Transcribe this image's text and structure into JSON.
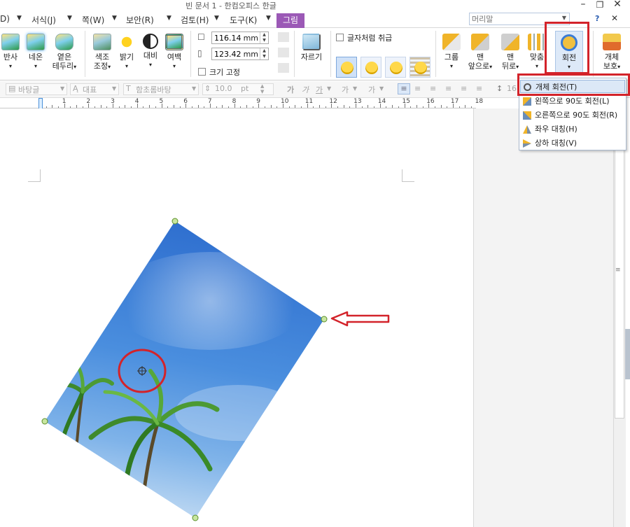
{
  "titlebar": {
    "title": "빈 문서 1 - 한컴오피스 한글",
    "min_glyph": "–",
    "max_glyph": "❐",
    "close_glyph": "✕"
  },
  "menubar": {
    "items": [
      "D)",
      "서식(J)",
      "쪽(W)",
      "보안(R)",
      "검토(H)",
      "도구(K)"
    ],
    "active_tab": "그림",
    "search_placeholder": "머리말",
    "help_glyph": "?",
    "ribbon_close_glyph": "✕"
  },
  "ribbon": {
    "reflect": "반사",
    "neon": "네온",
    "soft_edge_1": "옅은",
    "soft_edge_2": "테두리",
    "color_adjust_1": "색조",
    "color_adjust_2": "조정",
    "brightness": "밝기",
    "contrast": "대비",
    "margin": "여백",
    "width_value": "116.14",
    "height_value": "123.42",
    "unit": "mm",
    "fix_size": "크기 고정",
    "crop": "자르기",
    "treat_as_char": "글자처럼 취급",
    "group": "그룹",
    "bring_front_1": "맨",
    "bring_front_2": "앞으로",
    "send_back_1": "맨",
    "send_back_2": "뒤로",
    "align": "맞춤",
    "rotate": "회전",
    "protect_1": "개체",
    "protect_2": "보호"
  },
  "formatbar": {
    "style": "바탕글",
    "lang": "대표",
    "font": "함초롬바탕",
    "size": "10.0",
    "size_unit": "pt",
    "line_spacing": "16"
  },
  "ruler": {
    "numbers": [
      "1",
      "2",
      "3",
      "4",
      "5",
      "6",
      "7",
      "8",
      "9",
      "10",
      "11",
      "12",
      "13",
      "14",
      "15",
      "16",
      "17",
      "18"
    ]
  },
  "rotate_menu": {
    "items": [
      {
        "label": "개체 회전(T)",
        "icon": "rotate-free-icon"
      },
      {
        "label": "왼쪽으로 90도 회전(L)",
        "icon": "rotate-left-icon"
      },
      {
        "label": "오른쪽으로 90도 회전(R)",
        "icon": "rotate-right-icon"
      },
      {
        "label": "좌우 대칭(H)",
        "icon": "flip-horizontal-icon"
      },
      {
        "label": "상하 대칭(V)",
        "icon": "flip-vertical-icon"
      }
    ],
    "highlighted": 0
  },
  "colors": {
    "accent_tab": "#9b59b6",
    "annotation_red": "#d3232a",
    "handle_green": "#8bc34a",
    "menu_highlight": "#dce8f7"
  }
}
